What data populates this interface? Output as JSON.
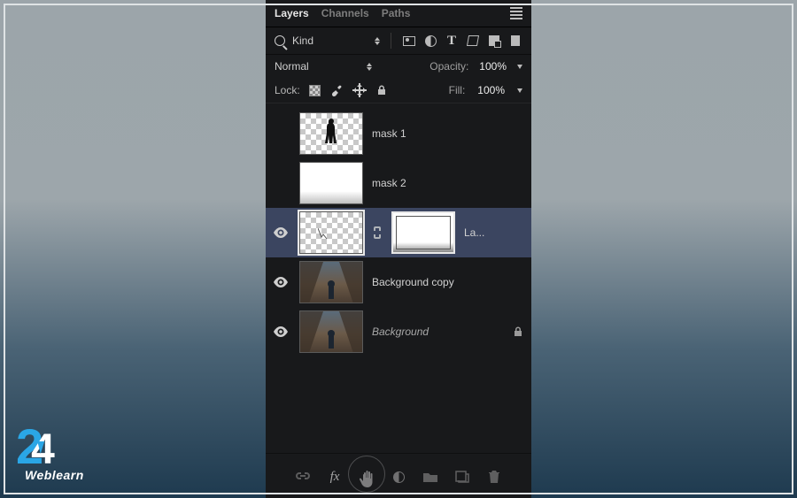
{
  "tabs": {
    "layers": "Layers",
    "channels": "Channels",
    "paths": "Paths"
  },
  "filter": {
    "kind": "Kind"
  },
  "blend": {
    "mode": "Normal",
    "opacity_label": "Opacity:",
    "opacity": "100%",
    "fill_label": "Fill:",
    "fill": "100%"
  },
  "lock": {
    "label": "Lock:"
  },
  "layers": [
    {
      "name": "mask 1"
    },
    {
      "name": "mask 2"
    },
    {
      "name": "La..."
    },
    {
      "name": "Background copy"
    },
    {
      "name": "Background"
    }
  ],
  "bottom": {
    "fx": "fx"
  },
  "logo": {
    "two": "2",
    "four": "4",
    "brand": "Weblearn"
  }
}
